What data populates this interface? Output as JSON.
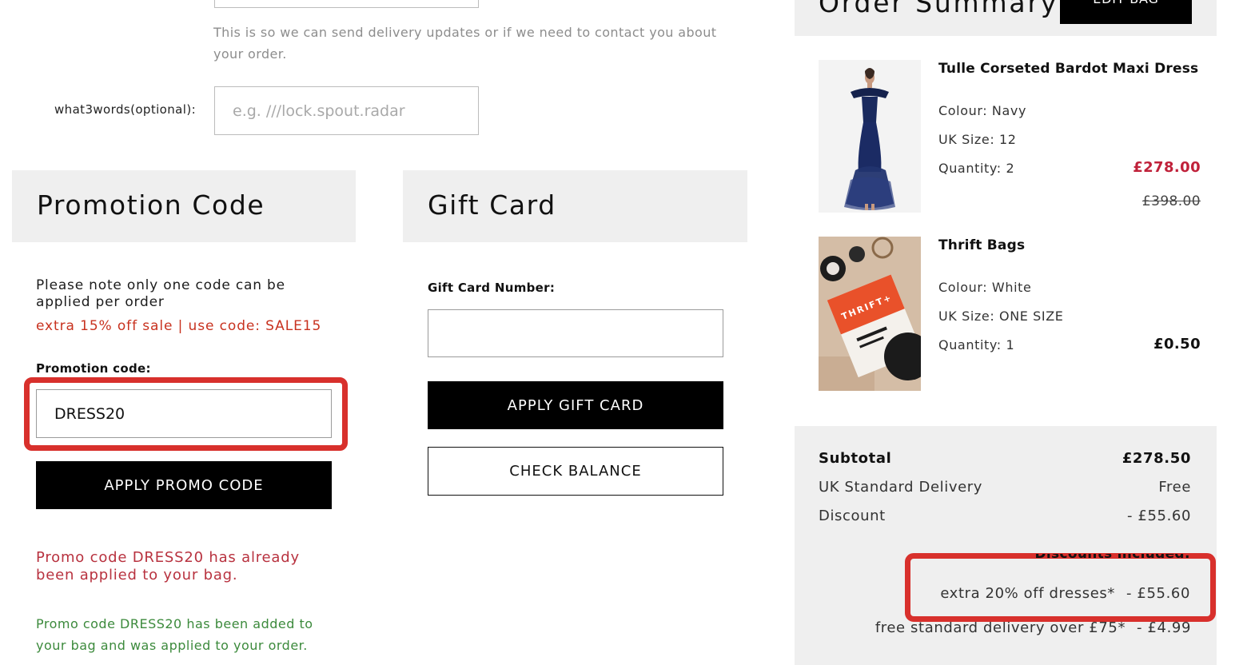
{
  "contact": {
    "phone_note": "This is so we can send delivery updates or if we need to contact you about your order.",
    "what3words_label": "what3words(optional):",
    "what3words_placeholder": "e.g. ///lock.spout.radar"
  },
  "promotion": {
    "title": "Promotion Code",
    "note": "Please note only one code can be applied per order",
    "offer": "extra 15% off sale | use code: SALE15",
    "field_label": "Promotion code:",
    "field_value": "DRESS20",
    "apply_button": "APPLY PROMO CODE",
    "error_message": "Promo code DRESS20 has already been applied to your bag.",
    "success_message": "Promo code DRESS20 has been added to your bag and was applied to your order."
  },
  "gift_card": {
    "title": "Gift Card",
    "field_label": "Gift Card Number:",
    "field_value": "",
    "apply_button": "APPLY GIFT CARD",
    "check_button": "CHECK BALANCE"
  },
  "order_summary": {
    "title": "Order Summary",
    "edit_button": "EDIT BAG",
    "items": [
      {
        "name": "Tulle Corseted Bardot Maxi Dress",
        "colour": "Colour: Navy",
        "size": "UK Size: 12",
        "quantity": "Quantity: 2",
        "price": "£278.00",
        "original_price": "£398.00"
      },
      {
        "name": "Thrift Bags",
        "colour": "Colour: White",
        "size": "UK Size: ONE SIZE",
        "quantity": "Quantity: 1",
        "price": "£0.50",
        "thrift_logo": "THRIFT+"
      }
    ],
    "subtotal_label": "Subtotal",
    "subtotal_value": "£278.50",
    "delivery_label": "UK Standard Delivery",
    "delivery_value": "Free",
    "discount_label": "Discount",
    "discount_value": "- £55.60",
    "discounts_included_label": "Discounts included:",
    "discounts": [
      {
        "label": "extra 20% off dresses*",
        "amount": "- £55.60"
      },
      {
        "label": "free standard delivery over £75*",
        "amount": "- £4.99"
      }
    ]
  },
  "colors": {
    "highlight": "#d8302c",
    "sale_price": "#c0213a",
    "offer_text": "#c8321f",
    "error_text": "#b8323f",
    "success_text": "#3c8a3c",
    "panel_bg": "#efefef"
  }
}
